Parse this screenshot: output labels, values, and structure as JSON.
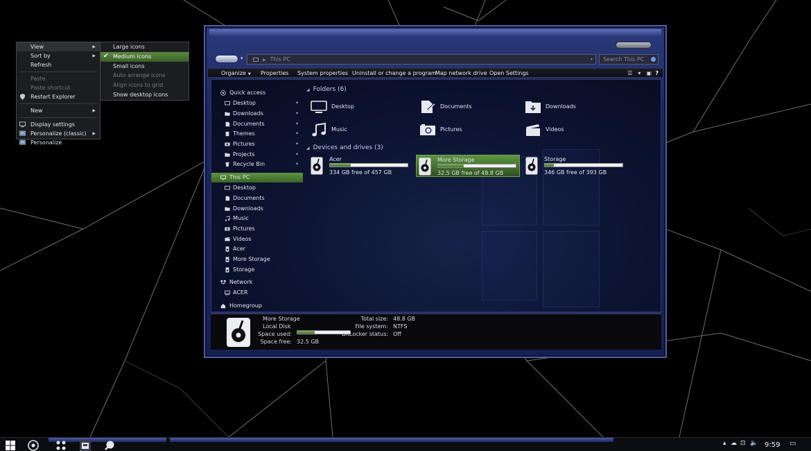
{
  "context_menu": {
    "items": [
      {
        "label": "View",
        "state": "highlighted",
        "submenu": true
      },
      {
        "label": "Sort by",
        "state": "normal",
        "submenu": true
      },
      {
        "label": "Refresh",
        "state": "normal"
      },
      {
        "label": "Paste",
        "state": "disabled"
      },
      {
        "label": "Paste shortcut",
        "state": "disabled"
      },
      {
        "label": "Restart Explorer",
        "state": "normal",
        "icon": "shield-icon"
      },
      {
        "label": "New",
        "state": "normal",
        "submenu": true
      },
      {
        "label": "Display settings",
        "state": "normal",
        "icon": "monitor-icon"
      },
      {
        "label": "Personalize (classic)",
        "state": "normal",
        "icon": "personalize-icon",
        "submenu": true
      },
      {
        "label": "Personalize",
        "state": "normal",
        "icon": "personalize-icon"
      }
    ]
  },
  "view_submenu": {
    "items": [
      {
        "label": "Large icons",
        "state": "normal"
      },
      {
        "label": "Medium icons",
        "state": "selected",
        "checked": true
      },
      {
        "label": "Small icons",
        "state": "normal"
      },
      {
        "label": "Auto arrange icons",
        "state": "disabled"
      },
      {
        "label": "Align icons to grid",
        "state": "disabled"
      },
      {
        "label": "Show desktop icons",
        "state": "normal"
      }
    ]
  },
  "explorer": {
    "address": {
      "location": "This PC",
      "search_placeholder": "Search This PC"
    },
    "commands": [
      "Organize",
      "Properties",
      "System properties",
      "Uninstall or change a program",
      "Map network drive",
      "Open Settings"
    ],
    "help": "?",
    "nav": {
      "quick_access": "Quick access",
      "quick_items": [
        "Desktop",
        "Downloads",
        "Documents",
        "Themes",
        "Pictures",
        "Projects",
        "Recycle Bin"
      ],
      "this_pc": "This PC",
      "pc_items": [
        "Desktop",
        "Documents",
        "Downloads",
        "Music",
        "Pictures",
        "Videos",
        "Acer",
        "More Storage",
        "Storage"
      ],
      "network": "Network",
      "network_items": [
        "ACER"
      ],
      "homegroup": "Homegroup"
    },
    "folders_header": "Folders (6)",
    "folders": [
      "Desktop",
      "Documents",
      "Downloads",
      "Music",
      "Pictures",
      "Videos"
    ],
    "drives_header": "Devices and drives (3)",
    "drives": [
      {
        "name": "Acer",
        "free_text": "334 GB free of 457 GB",
        "used_fraction": 0.27,
        "selected": false
      },
      {
        "name": "More Storage",
        "free_text": "32.5 GB free of 48.8 GB",
        "used_fraction": 0.33,
        "selected": true
      },
      {
        "name": "Storage",
        "free_text": "346 GB free of 393 GB",
        "used_fraction": 0.12,
        "selected": false
      }
    ],
    "details": {
      "name": "More Storage",
      "type": "Local Disk",
      "space_used_label": "Space used:",
      "space_used_fraction": 0.33,
      "space_free_label": "Space free:",
      "space_free_value": "32.5 GB",
      "total_size_label": "Total size:",
      "total_size_value": "48.8 GB",
      "file_system_label": "File system:",
      "file_system_value": "NTFS",
      "bitlocker_label": "BitLocker status:",
      "bitlocker_value": "Off"
    }
  },
  "taskbar": {
    "clock": "9:59",
    "icons": [
      "start-icon",
      "browser-icon",
      "apps-icon",
      "file-explorer-icon",
      "paint-icon"
    ]
  },
  "colors": {
    "selection_green": "#4f8036",
    "window_blue": "#1b2660",
    "menu_bg": "#1c1d20"
  }
}
